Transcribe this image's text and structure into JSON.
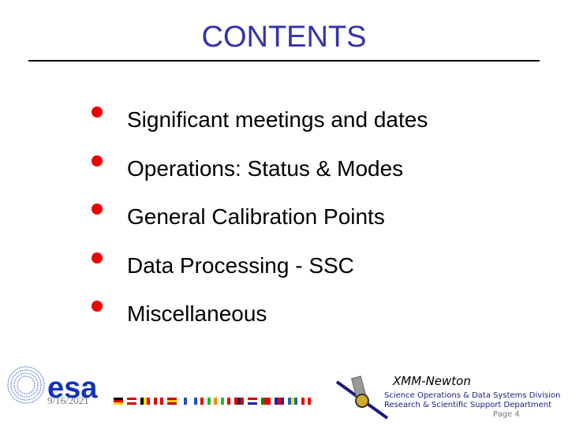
{
  "slide": {
    "title": "CONTENTS",
    "bullets": [
      {
        "label": "Significant meetings and dates"
      },
      {
        "label": "Operations: Status & Modes"
      },
      {
        "label": "General Calibration Points"
      },
      {
        "label": "Data Processing - SSC"
      },
      {
        "label": "Miscellaneous"
      }
    ]
  },
  "footer": {
    "logo_text": "esa",
    "date": "9/16/2021",
    "mission": "XMM-Newton",
    "division": "Science Operations & Data Systems Division",
    "department": "Research & Scientific Support Department",
    "page": "Page 4",
    "flags": [
      "germany",
      "austria",
      "belgium",
      "denmark",
      "spain",
      "finland",
      "france",
      "ireland",
      "italy",
      "norway",
      "netherlands",
      "portugal",
      "uk",
      "sweden",
      "switzerland"
    ]
  },
  "colors": {
    "title": "#3333aa",
    "bullet": "#ee0000",
    "esa_blue": "#1133bb"
  }
}
